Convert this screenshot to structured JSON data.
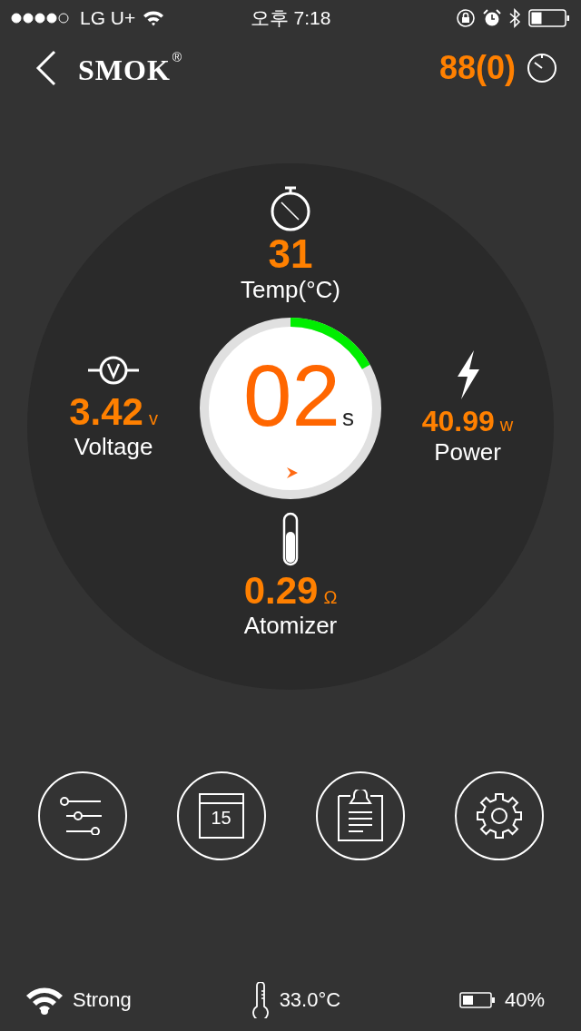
{
  "status_bar": {
    "carrier": "LG U+",
    "time": "오후 7:18"
  },
  "header": {
    "brand": "SMOK",
    "registered": "®",
    "puff_count": "88(0)"
  },
  "gauge": {
    "temp": {
      "value": "31",
      "label": "Temp(°C)"
    },
    "voltage": {
      "value": "3.42",
      "unit": "v",
      "label": "Voltage"
    },
    "timer": {
      "value": "02",
      "unit": "s"
    },
    "power": {
      "value": "40.99",
      "unit": "w",
      "label": "Power"
    },
    "atomizer": {
      "value": "0.29",
      "unit": "Ω",
      "label": "Atomizer"
    }
  },
  "actions": [
    {
      "kind": "sliders"
    },
    {
      "kind": "calendar",
      "label": "15"
    },
    {
      "kind": "clipboard"
    },
    {
      "kind": "settings"
    }
  ],
  "footer": {
    "signal": "Strong",
    "temperature": "33.0°C",
    "battery": "40%"
  }
}
